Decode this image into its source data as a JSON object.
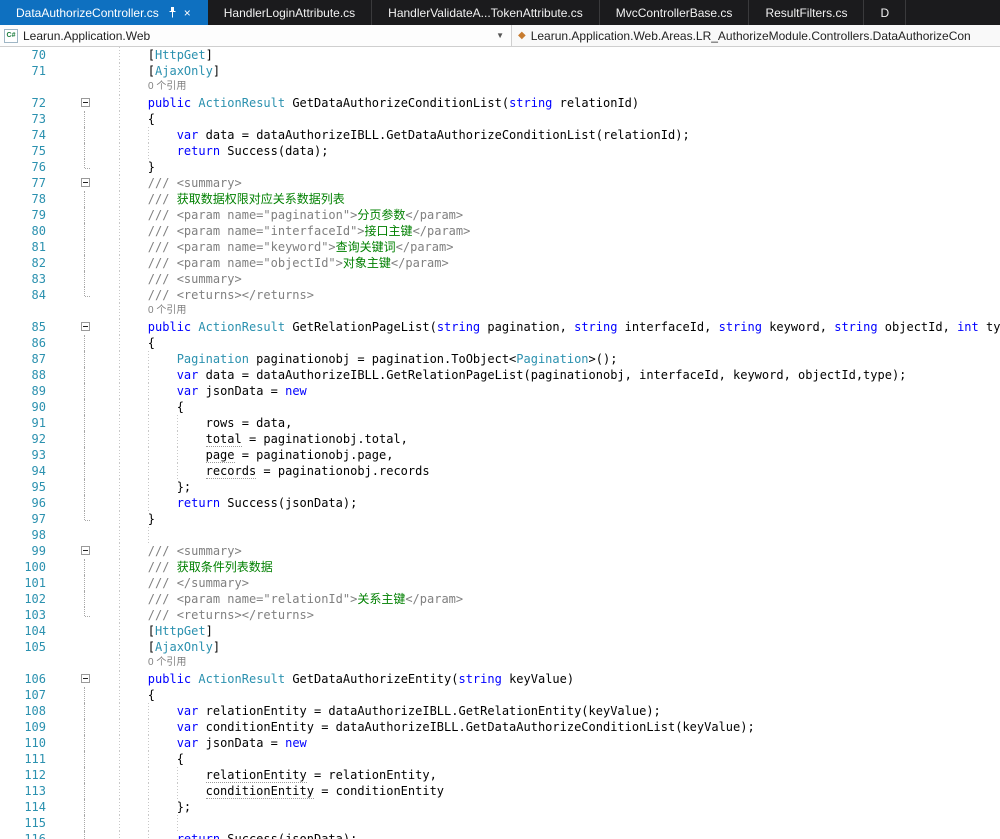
{
  "colors": {
    "active_tab": "#0e70c0",
    "tab_bar_bg": "#1b1b1d",
    "keyword": "#0000ff",
    "type_name": "#2b91af",
    "doc_tag": "#808080",
    "doc_text": "#008000",
    "line_number": "#2b91af"
  },
  "tabs": [
    {
      "label": "DataAuthorizeController.cs",
      "active": true,
      "pinned": true,
      "closable": true
    },
    {
      "label": "HandlerLoginAttribute.cs"
    },
    {
      "label": "HandlerValidateA...TokenAttribute.cs"
    },
    {
      "label": "MvcControllerBase.cs"
    },
    {
      "label": "ResultFilters.cs"
    },
    {
      "label": "D"
    }
  ],
  "breadcrumb": {
    "project": "Learun.Application.Web",
    "path": "Learun.Application.Web.Areas.LR_AuthorizeModule.Controllers.DataAuthorizeCon"
  },
  "editor": {
    "codelens_label": "0 个引用",
    "lines": [
      {
        "n": 70,
        "f": "",
        "s": [
          [
            "p",
            "        ["
          ],
          [
            "t",
            "HttpGet"
          ],
          [
            "p",
            "]"
          ]
        ]
      },
      {
        "n": 71,
        "f": "",
        "s": [
          [
            "p",
            "        ["
          ],
          [
            "t",
            "AjaxOnly"
          ],
          [
            "p",
            "]"
          ]
        ]
      },
      {
        "lens": true,
        "s": [
          [
            "cl",
            "0 个引用"
          ]
        ]
      },
      {
        "n": 72,
        "f": "box",
        "s": [
          [
            "p",
            "        "
          ],
          [
            "k",
            "public"
          ],
          [
            "p",
            " "
          ],
          [
            "t",
            "ActionResult"
          ],
          [
            "p",
            " GetDataAuthorizeConditionList("
          ],
          [
            "k",
            "string"
          ],
          [
            "p",
            " relationId)"
          ]
        ]
      },
      {
        "n": 73,
        "f": "line",
        "s": [
          [
            "p",
            "        {"
          ]
        ]
      },
      {
        "n": 74,
        "f": "line",
        "s": [
          [
            "p",
            "            "
          ],
          [
            "k",
            "var"
          ],
          [
            "p",
            " data = dataAuthorizeIBLL.GetDataAuthorizeConditionList(relationId);"
          ]
        ]
      },
      {
        "n": 75,
        "f": "line",
        "s": [
          [
            "p",
            "            "
          ],
          [
            "k",
            "return"
          ],
          [
            "p",
            " Success(data);"
          ]
        ]
      },
      {
        "n": 76,
        "f": "end",
        "s": [
          [
            "p",
            "        }"
          ]
        ]
      },
      {
        "n": 77,
        "f": "box",
        "s": [
          [
            "g",
            "        /// <summary>"
          ]
        ]
      },
      {
        "n": 78,
        "f": "line",
        "s": [
          [
            "g",
            "        /// "
          ],
          [
            "c",
            "获取数据权限对应关系数据列表"
          ]
        ]
      },
      {
        "n": 79,
        "f": "line",
        "s": [
          [
            "g",
            "        /// <param name=\"pagination\">"
          ],
          [
            "c",
            "分页参数"
          ],
          [
            "g",
            "</param>"
          ]
        ]
      },
      {
        "n": 80,
        "f": "line",
        "s": [
          [
            "g",
            "        /// <param name=\"interfaceId\">"
          ],
          [
            "c",
            "接口主键"
          ],
          [
            "g",
            "</param>"
          ]
        ]
      },
      {
        "n": 81,
        "f": "line",
        "s": [
          [
            "g",
            "        /// <param name=\"keyword\">"
          ],
          [
            "c",
            "查询关键词"
          ],
          [
            "g",
            "</param>"
          ]
        ]
      },
      {
        "n": 82,
        "f": "line",
        "s": [
          [
            "g",
            "        /// <param name=\"objectId\">"
          ],
          [
            "c",
            "对象主键"
          ],
          [
            "g",
            "</param>"
          ]
        ]
      },
      {
        "n": 83,
        "f": "line",
        "s": [
          [
            "g",
            "        /// <summary>"
          ]
        ]
      },
      {
        "n": 84,
        "f": "end",
        "s": [
          [
            "g",
            "        /// <returns></returns>"
          ]
        ]
      },
      {
        "lens": true,
        "s": [
          [
            "cl",
            "0 个引用"
          ]
        ]
      },
      {
        "n": 85,
        "f": "box",
        "s": [
          [
            "p",
            "        "
          ],
          [
            "k",
            "public"
          ],
          [
            "p",
            " "
          ],
          [
            "t",
            "ActionResult"
          ],
          [
            "p",
            " GetRelationPageList("
          ],
          [
            "k",
            "string"
          ],
          [
            "p",
            " pagination, "
          ],
          [
            "k",
            "string"
          ],
          [
            "p",
            " interfaceId, "
          ],
          [
            "k",
            "string"
          ],
          [
            "p",
            " keyword, "
          ],
          [
            "k",
            "string"
          ],
          [
            "p",
            " objectId, "
          ],
          [
            "k",
            "int"
          ],
          [
            "p",
            " type)"
          ]
        ]
      },
      {
        "n": 86,
        "f": "line",
        "s": [
          [
            "p",
            "        {"
          ]
        ]
      },
      {
        "n": 87,
        "f": "line",
        "s": [
          [
            "p",
            "            "
          ],
          [
            "t",
            "Pagination"
          ],
          [
            "p",
            " paginationobj = pagination.ToObject<"
          ],
          [
            "t",
            "Pagination"
          ],
          [
            "p",
            ">();"
          ]
        ]
      },
      {
        "n": 88,
        "f": "line",
        "s": [
          [
            "p",
            "            "
          ],
          [
            "k",
            "var"
          ],
          [
            "p",
            " data = dataAuthorizeIBLL.GetRelationPageList(paginationobj, interfaceId, keyword, objectId,type);"
          ]
        ]
      },
      {
        "n": 89,
        "f": "line",
        "s": [
          [
            "p",
            "            "
          ],
          [
            "k",
            "var"
          ],
          [
            "p",
            " jsonData = "
          ],
          [
            "k",
            "new"
          ]
        ]
      },
      {
        "n": 90,
        "f": "line",
        "s": [
          [
            "p",
            "            {"
          ]
        ]
      },
      {
        "n": 91,
        "f": "line",
        "s": [
          [
            "p",
            "                rows = data,"
          ]
        ]
      },
      {
        "n": 92,
        "f": "line",
        "s": [
          [
            "p",
            "                "
          ],
          [
            "u",
            "total"
          ],
          [
            "p",
            " = paginationobj.total,"
          ]
        ]
      },
      {
        "n": 93,
        "f": "line",
        "s": [
          [
            "p",
            "                "
          ],
          [
            "u",
            "page"
          ],
          [
            "p",
            " = paginationobj.page,"
          ]
        ]
      },
      {
        "n": 94,
        "f": "line",
        "s": [
          [
            "p",
            "                "
          ],
          [
            "u",
            "records"
          ],
          [
            "p",
            " = paginationobj.records"
          ]
        ]
      },
      {
        "n": 95,
        "f": "line",
        "s": [
          [
            "p",
            "            };"
          ]
        ]
      },
      {
        "n": 96,
        "f": "line",
        "s": [
          [
            "p",
            "            "
          ],
          [
            "k",
            "return"
          ],
          [
            "p",
            " Success(jsonData);"
          ]
        ]
      },
      {
        "n": 97,
        "f": "end",
        "s": [
          [
            "p",
            "        }"
          ]
        ]
      },
      {
        "n": 98,
        "f": "",
        "s": [
          [
            "p",
            "            "
          ]
        ]
      },
      {
        "n": 99,
        "f": "box",
        "s": [
          [
            "g",
            "        /// <summary>"
          ]
        ]
      },
      {
        "n": 100,
        "f": "line",
        "s": [
          [
            "g",
            "        /// "
          ],
          [
            "c",
            "获取条件列表数据"
          ]
        ]
      },
      {
        "n": 101,
        "f": "line",
        "s": [
          [
            "g",
            "        /// </summary>"
          ]
        ]
      },
      {
        "n": 102,
        "f": "line",
        "s": [
          [
            "g",
            "        /// <param name=\"relationId\">"
          ],
          [
            "c",
            "关系主键"
          ],
          [
            "g",
            "</param>"
          ]
        ]
      },
      {
        "n": 103,
        "f": "end",
        "s": [
          [
            "g",
            "        /// <returns></returns>"
          ]
        ]
      },
      {
        "n": 104,
        "f": "",
        "s": [
          [
            "p",
            "        ["
          ],
          [
            "t",
            "HttpGet"
          ],
          [
            "p",
            "]"
          ]
        ]
      },
      {
        "n": 105,
        "f": "",
        "s": [
          [
            "p",
            "        ["
          ],
          [
            "t",
            "AjaxOnly"
          ],
          [
            "p",
            "]"
          ]
        ]
      },
      {
        "lens": true,
        "s": [
          [
            "cl",
            "0 个引用"
          ]
        ]
      },
      {
        "n": 106,
        "f": "box",
        "s": [
          [
            "p",
            "        "
          ],
          [
            "k",
            "public"
          ],
          [
            "p",
            " "
          ],
          [
            "t",
            "ActionResult"
          ],
          [
            "p",
            " GetDataAuthorizeEntity("
          ],
          [
            "k",
            "string"
          ],
          [
            "p",
            " keyValue)"
          ]
        ]
      },
      {
        "n": 107,
        "f": "line",
        "s": [
          [
            "p",
            "        {"
          ]
        ]
      },
      {
        "n": 108,
        "f": "line",
        "s": [
          [
            "p",
            "            "
          ],
          [
            "k",
            "var"
          ],
          [
            "p",
            " relationEntity = dataAuthorizeIBLL.GetRelationEntity(keyValue);"
          ]
        ]
      },
      {
        "n": 109,
        "f": "line",
        "s": [
          [
            "p",
            "            "
          ],
          [
            "k",
            "var"
          ],
          [
            "p",
            " conditionEntity = dataAuthorizeIBLL.GetDataAuthorizeConditionList(keyValue);"
          ]
        ]
      },
      {
        "n": 110,
        "f": "line",
        "s": [
          [
            "p",
            "            "
          ],
          [
            "k",
            "var"
          ],
          [
            "p",
            " jsonData = "
          ],
          [
            "k",
            "new"
          ]
        ]
      },
      {
        "n": 111,
        "f": "line",
        "s": [
          [
            "p",
            "            {"
          ]
        ]
      },
      {
        "n": 112,
        "f": "line",
        "s": [
          [
            "p",
            "                "
          ],
          [
            "u",
            "relationEntity"
          ],
          [
            "p",
            " = relationEntity,"
          ]
        ]
      },
      {
        "n": 113,
        "f": "line",
        "s": [
          [
            "p",
            "                "
          ],
          [
            "u",
            "conditionEntity"
          ],
          [
            "p",
            " = conditionEntity"
          ]
        ]
      },
      {
        "n": 114,
        "f": "line",
        "s": [
          [
            "p",
            "            };"
          ]
        ]
      },
      {
        "n": 115,
        "f": "line",
        "s": [
          [
            "p",
            "                "
          ]
        ]
      },
      {
        "n": 116,
        "f": "line",
        "s": [
          [
            "p",
            "            "
          ],
          [
            "k",
            "return"
          ],
          [
            "p",
            " Success(jsonData);"
          ]
        ]
      }
    ]
  }
}
